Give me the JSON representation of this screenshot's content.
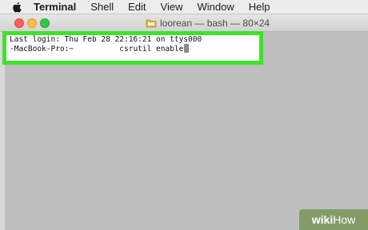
{
  "menubar": {
    "items": [
      "Terminal",
      "Shell",
      "Edit",
      "View",
      "Window",
      "Help"
    ],
    "apple_icon": "apple-icon"
  },
  "window": {
    "title": "loorean — bash — 80×24",
    "folder_icon": "folder-icon"
  },
  "terminal": {
    "line1": "Last login: Thu Feb 28 22:16:21 on ttys000",
    "line2_host": "-MacBook-Pro:~",
    "line2_command": "csrutil enable"
  },
  "watermark": {
    "wiki": "wiki",
    "how": "How"
  },
  "colors": {
    "highlight": "#3fe22a",
    "close": "#fc605c",
    "minimize": "#fdbc40",
    "maximize": "#34c84a"
  }
}
